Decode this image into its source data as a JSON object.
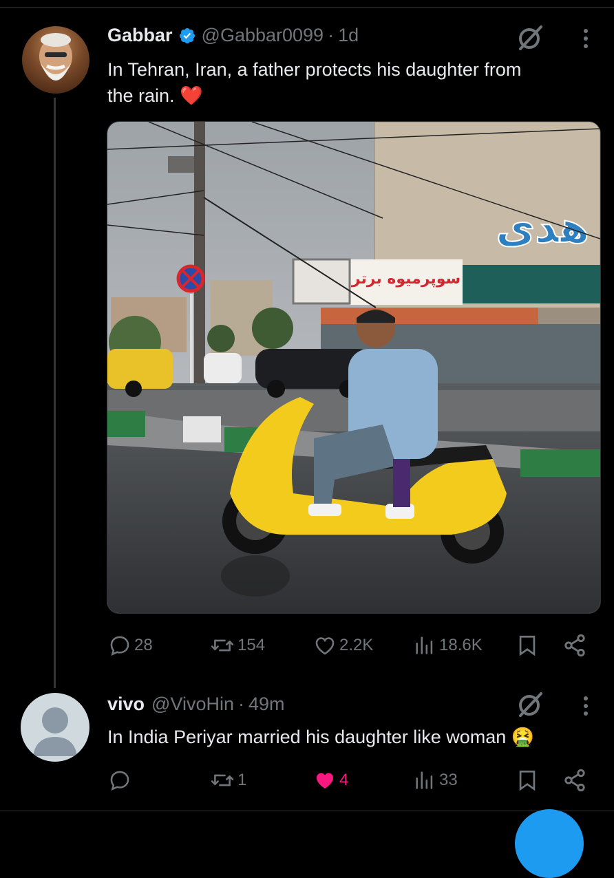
{
  "posts": [
    {
      "author_name": "Gabbar",
      "handle": "@Gabbar0099",
      "separator": "·",
      "time": "1d",
      "text": "In Tehran, Iran, a father protects his daughter from the rain. ❤️",
      "text_line1": "In Tehran, Iran, a father protects his daughter from",
      "text_line2": "the rain.",
      "emoji": "❤️",
      "verified": true,
      "stats": {
        "replies": "28",
        "reposts": "154",
        "likes": "2.2K",
        "views": "18.6K"
      },
      "media_sign_text": "سوپرمیوه برتر"
    },
    {
      "author_name": "vivo",
      "handle": "@VivoHin",
      "separator": "·",
      "time": "49m",
      "text_main": "In India Periyar married his daughter like woman",
      "emoji": "🤮",
      "stats": {
        "replies": "",
        "reposts": "1",
        "likes": "4",
        "views": "33"
      },
      "liked": true
    }
  ],
  "icons": [
    "reply-icon",
    "repost-icon",
    "like-icon",
    "views-icon",
    "bookmark-icon",
    "share-icon",
    "grok-icon",
    "more-icon",
    "verified-icon"
  ],
  "colors": {
    "background": "#000000",
    "text": "#e7e9ea",
    "muted": "#71767b",
    "verified": "#1d9bf0",
    "like": "#f91880",
    "divider": "#2f3336"
  }
}
